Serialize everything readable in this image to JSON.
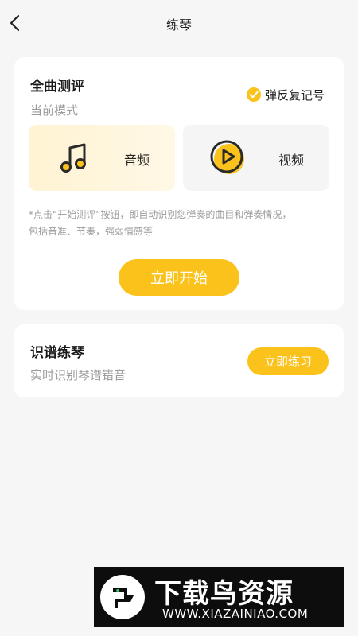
{
  "header": {
    "title": "练琴"
  },
  "full_test": {
    "title": "全曲测评",
    "mode_label": "当前模式",
    "repeat_label": "弹反复记号",
    "repeat_checked": true,
    "modes": [
      {
        "label": "音频",
        "icon": "music-note-icon",
        "selected": true
      },
      {
        "label": "视频",
        "icon": "play-circle-icon",
        "selected": false
      }
    ],
    "hint_line1": "*点击“开始测评”按钮，即自动识别您弹奏的曲目和弹奏情况，",
    "hint_line2": "包括音准、节奏，强弱情感等",
    "start_label": "立即开始"
  },
  "score_practice": {
    "title": "识谱练琴",
    "subtitle": "实时识别琴谱错音",
    "button_label": "立即练习"
  },
  "watermark": {
    "title": "下载鸟资源",
    "url": "WWW.XIAZAINIAO.COM"
  },
  "colors": {
    "accent": "#fbc21b",
    "background": "#f6f6f6",
    "card": "#ffffff"
  }
}
